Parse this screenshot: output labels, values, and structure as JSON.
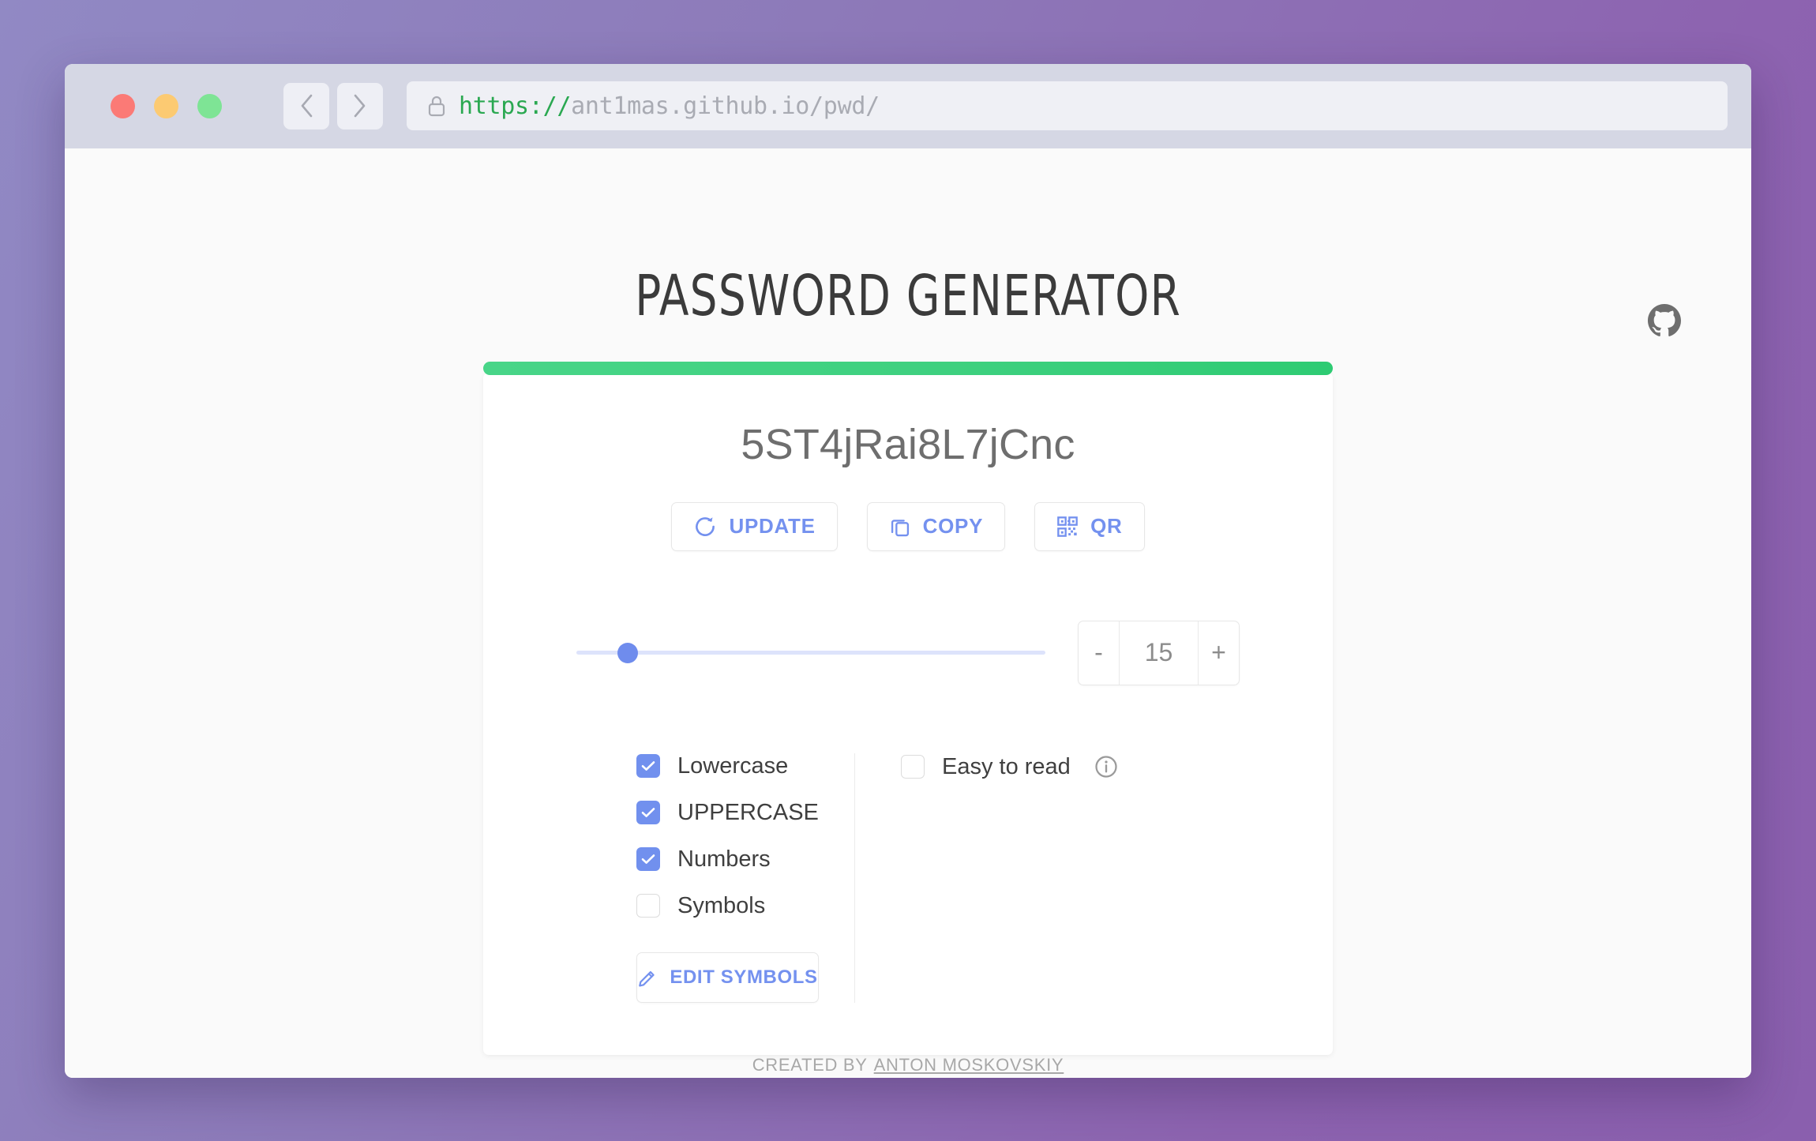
{
  "browser": {
    "traffic_lights": [
      "close",
      "minimize",
      "maximize"
    ],
    "back_label": "Back",
    "forward_label": "Forward",
    "url_scheme": "https://",
    "url_host": "ant1mas.github.io/pwd/",
    "lock_icon": "lock-icon"
  },
  "header": {
    "title": "PASSWORD GENERATOR",
    "github_icon": "github-icon"
  },
  "strength": {
    "color": "#3ed07f",
    "level": "strong"
  },
  "password": {
    "value": "5ST4jRai8L7jCnc"
  },
  "actions": [
    {
      "label": "UPDATE",
      "icon": "refresh-icon"
    },
    {
      "label": "COPY",
      "icon": "copy-icon"
    },
    {
      "label": "QR",
      "icon": "qr-code-icon"
    }
  ],
  "length": {
    "value": "15",
    "minus_label": "-",
    "plus_label": "+",
    "slider_percent": 9
  },
  "options": {
    "left": [
      {
        "label": "Lowercase",
        "checked": true
      },
      {
        "label": "UPPERCASE",
        "checked": true
      },
      {
        "label": "Numbers",
        "checked": true
      },
      {
        "label": "Symbols",
        "checked": false
      }
    ],
    "edit_symbols": {
      "label": "EDIT SYMBOLS",
      "icon": "pencil-icon"
    },
    "right": [
      {
        "label": "Easy to read",
        "checked": false,
        "info_icon": "info-icon"
      }
    ]
  },
  "footer": {
    "prefix": "CREATED BY",
    "author": "ANTON MOSKOVSKIY"
  },
  "colors": {
    "accent": "#7190ee",
    "strength": "#3ed07f",
    "background_start": "#9189c4",
    "background_end": "#8a5fae"
  }
}
